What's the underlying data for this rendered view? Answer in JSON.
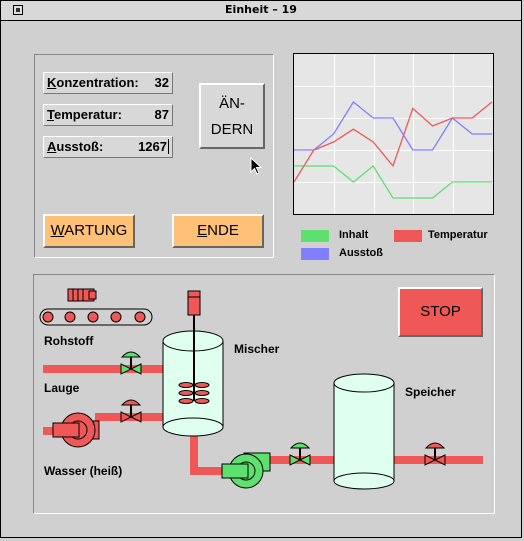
{
  "window": {
    "title": "Einheit – 19"
  },
  "fields": [
    {
      "label": "Konzentration:",
      "underline": "K",
      "rest": "onzentration:",
      "value": "32"
    },
    {
      "label": "Temperatur:",
      "underline": "T",
      "rest": "emperatur:",
      "value": "87"
    },
    {
      "label": "Ausstoß:",
      "underline": "A",
      "rest": "usstoß:",
      "value": "1267"
    }
  ],
  "buttons": {
    "aendern_line1": "ÄN-",
    "aendern_line2": "DERN",
    "wartung_u": "W",
    "wartung_rest": "ARTUNG",
    "ende_u": "E",
    "ende_rest": "NDE",
    "stop": "STOP"
  },
  "legend": [
    {
      "name": "Inhalt",
      "color": "#5ee06e"
    },
    {
      "name": "Temperatur",
      "color": "#f05858"
    },
    {
      "name": "Ausstoß",
      "color": "#7f7fff"
    }
  ],
  "chart_data": {
    "type": "line",
    "x": [
      0,
      1,
      2,
      3,
      4,
      5,
      6,
      7,
      8,
      9,
      10
    ],
    "ylim": [
      0,
      100
    ],
    "grid": true,
    "series": [
      {
        "name": "Inhalt",
        "color": "#5ee06e",
        "values": [
          30,
          30,
          30,
          20,
          30,
          10,
          10,
          10,
          20,
          20,
          20
        ]
      },
      {
        "name": "Ausstoß",
        "color": "#7f7fff",
        "values": [
          40,
          40,
          50,
          70,
          60,
          60,
          40,
          40,
          60,
          50,
          50
        ]
      },
      {
        "name": "Temperatur",
        "color": "#f05858",
        "values": [
          20,
          40,
          45,
          53,
          45,
          30,
          66,
          55,
          60,
          60,
          70
        ]
      }
    ]
  },
  "plant": {
    "rohstoff": "Rohstoff",
    "lauge": "Lauge",
    "wasser": "Wasser (heiß)",
    "mischer": "Mischer",
    "speicher": "Speicher"
  },
  "colors": {
    "pipe": "#f05858",
    "valve_green": "#5ee06e",
    "tank_fill": "#dfffef"
  }
}
